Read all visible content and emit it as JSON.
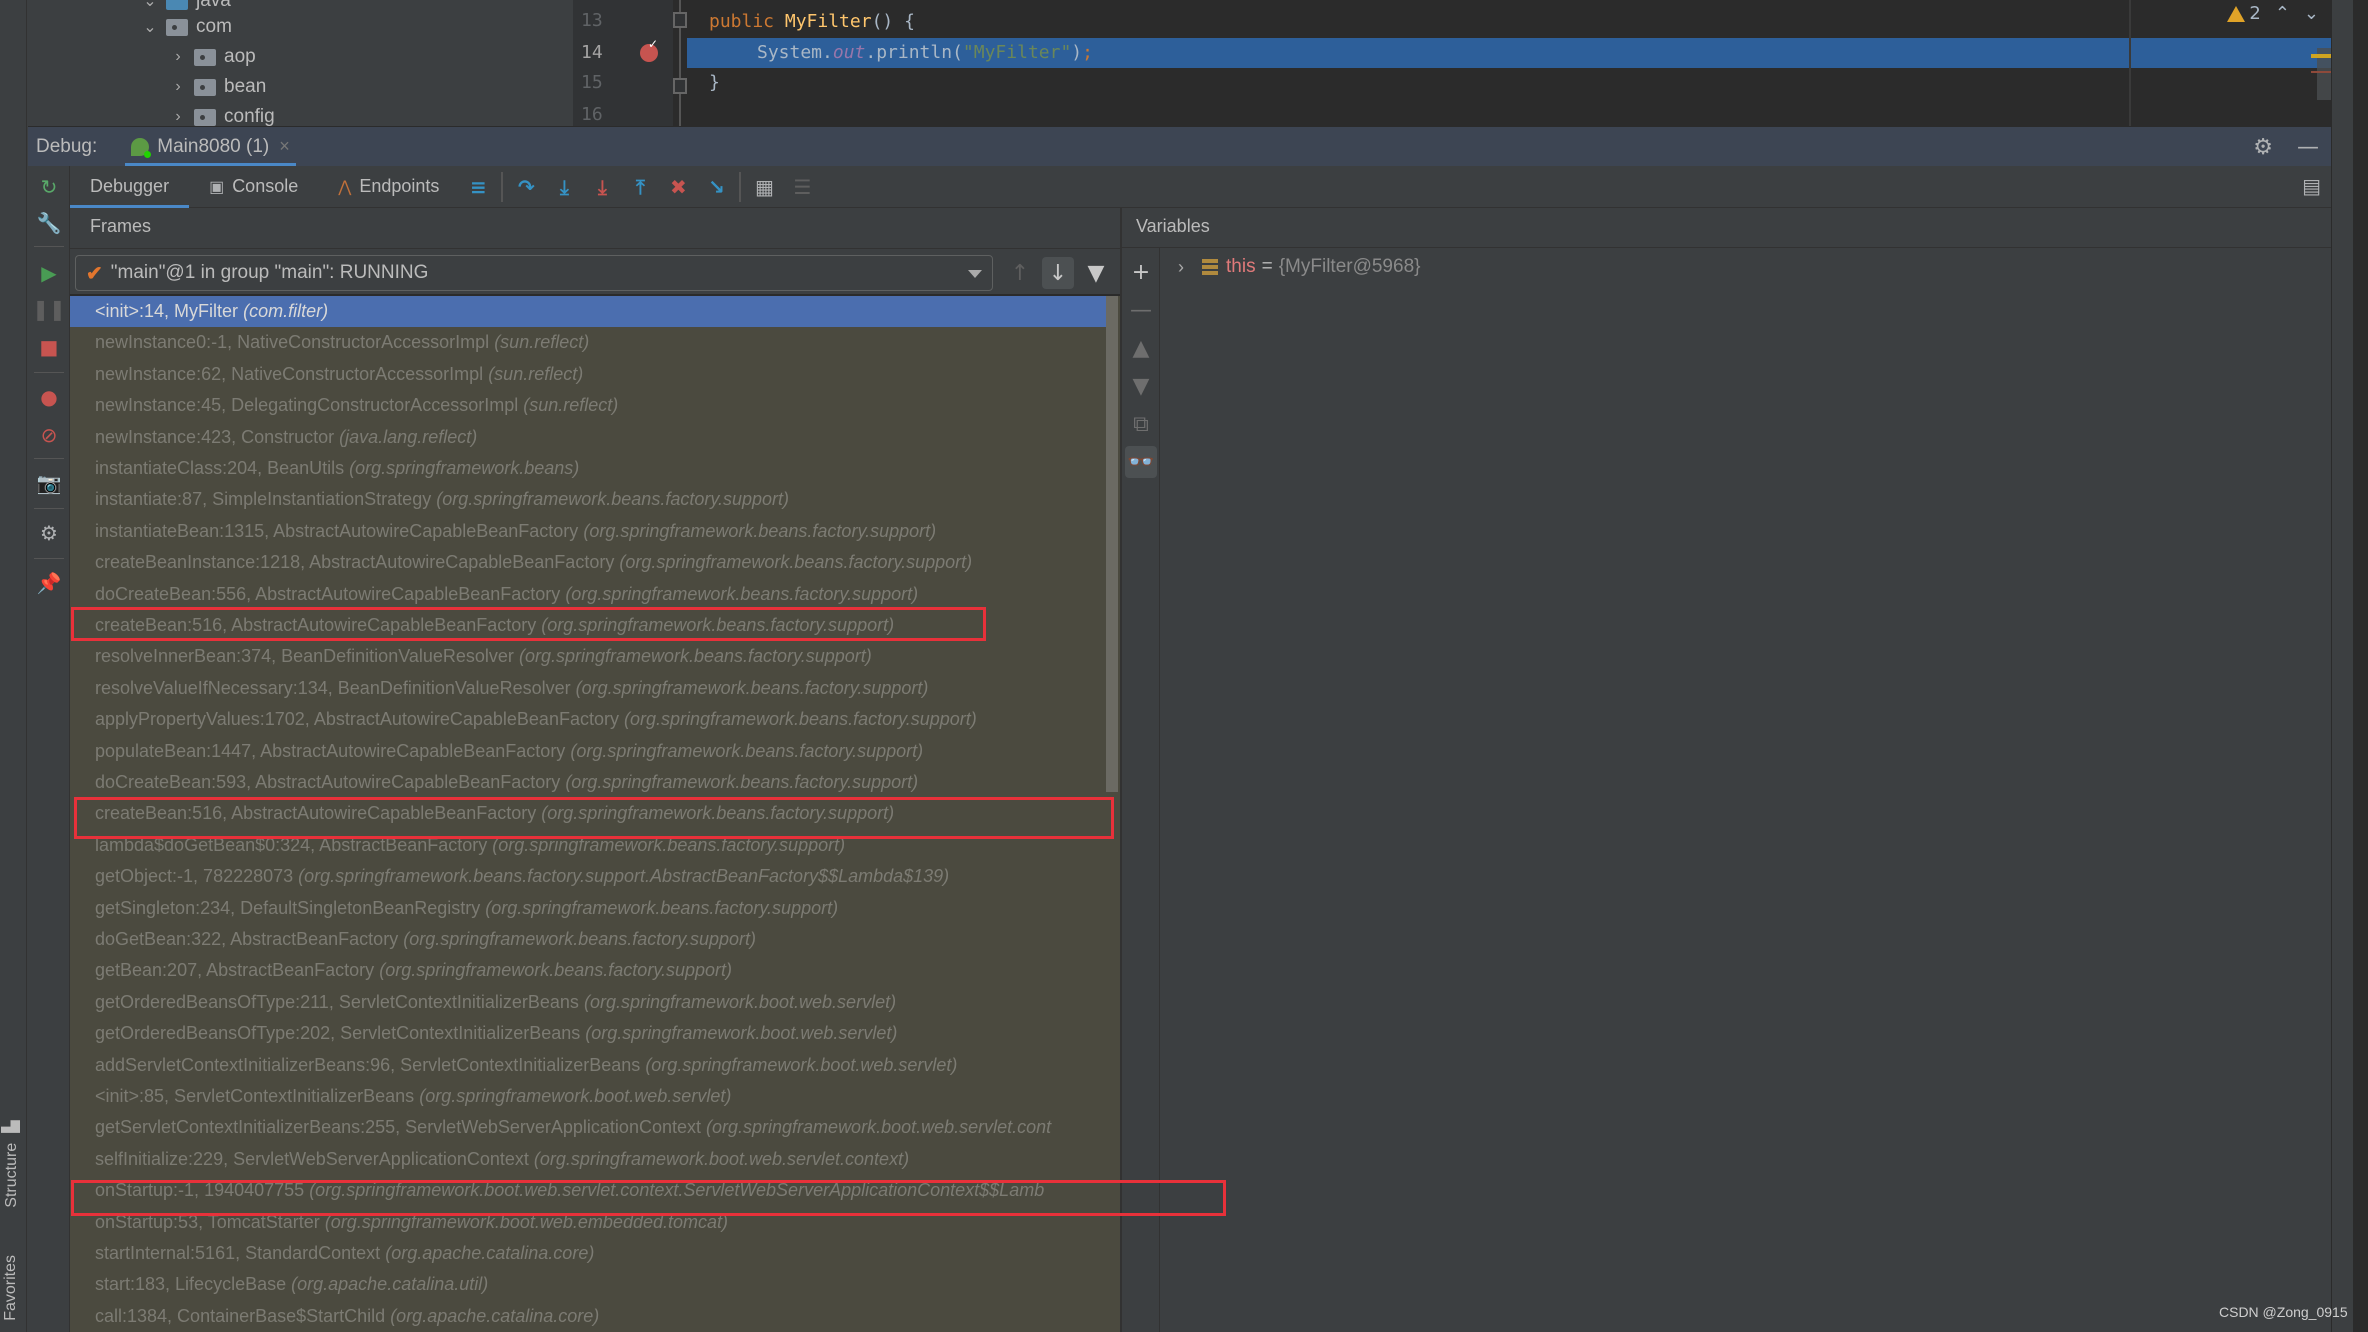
{
  "project_tree": {
    "items": [
      {
        "label": "java",
        "expanded": true
      },
      {
        "label": "com",
        "expanded": true
      },
      {
        "label": "aop",
        "expanded": false
      },
      {
        "label": "bean",
        "expanded": false
      },
      {
        "label": "config",
        "expanded": false
      }
    ]
  },
  "editor": {
    "lines": [
      {
        "number": "13",
        "code": "public MyFilter() {"
      },
      {
        "number": "14",
        "code": "System.out.println(\"MyFilter\");",
        "current": true,
        "breakpoint": true
      },
      {
        "number": "15",
        "code": "}"
      },
      {
        "number": "16",
        "code": ""
      }
    ],
    "warnings_count": "2"
  },
  "debug": {
    "label": "Debug:",
    "session_tab": "Main8080 (1)",
    "tabs": [
      {
        "label": "Debugger",
        "active": true
      },
      {
        "label": "Console",
        "active": false
      },
      {
        "label": "Endpoints",
        "active": false
      }
    ],
    "toolbar_icons": [
      "show-execution-point-icon",
      "step-over-icon",
      "step-into-icon",
      "force-step-into-icon",
      "step-out-icon",
      "drop-frame-icon",
      "run-to-cursor-icon",
      "evaluate-expression-icon",
      "trace-current-stream-icon"
    ],
    "side_tools": [
      "rerun-icon",
      "modify-settings-icon",
      "resume-icon",
      "pause-icon",
      "stop-icon",
      "view-breakpoints-icon",
      "mute-breakpoints-icon",
      "snapshot-icon",
      "settings-icon",
      "pin-icon"
    ]
  },
  "frames": {
    "title": "Frames",
    "thread": "\"main\"@1 in group \"main\": RUNNING",
    "items": [
      {
        "method": "<init>:14, MyFilter",
        "pkg": "(com.filter)",
        "selected": true
      },
      {
        "method": "newInstance0:-1, NativeConstructorAccessorImpl",
        "pkg": "(sun.reflect)"
      },
      {
        "method": "newInstance:62, NativeConstructorAccessorImpl",
        "pkg": "(sun.reflect)"
      },
      {
        "method": "newInstance:45, DelegatingConstructorAccessorImpl",
        "pkg": "(sun.reflect)"
      },
      {
        "method": "newInstance:423, Constructor",
        "pkg": "(java.lang.reflect)"
      },
      {
        "method": "instantiateClass:204, BeanUtils",
        "pkg": "(org.springframework.beans)"
      },
      {
        "method": "instantiate:87, SimpleInstantiationStrategy",
        "pkg": "(org.springframework.beans.factory.support)"
      },
      {
        "method": "instantiateBean:1315, AbstractAutowireCapableBeanFactory",
        "pkg": "(org.springframework.beans.factory.support)"
      },
      {
        "method": "createBeanInstance:1218, AbstractAutowireCapableBeanFactory",
        "pkg": "(org.springframework.beans.factory.support)"
      },
      {
        "method": "doCreateBean:556, AbstractAutowireCapableBeanFactory",
        "pkg": "(org.springframework.beans.factory.support)"
      },
      {
        "method": "createBean:516, AbstractAutowireCapableBeanFactory",
        "pkg": "(org.springframework.beans.factory.support)",
        "highlighted": true
      },
      {
        "method": "resolveInnerBean:374, BeanDefinitionValueResolver",
        "pkg": "(org.springframework.beans.factory.support)"
      },
      {
        "method": "resolveValueIfNecessary:134, BeanDefinitionValueResolver",
        "pkg": "(org.springframework.beans.factory.support)"
      },
      {
        "method": "applyPropertyValues:1702, AbstractAutowireCapableBeanFactory",
        "pkg": "(org.springframework.beans.factory.support)"
      },
      {
        "method": "populateBean:1447, AbstractAutowireCapableBeanFactory",
        "pkg": "(org.springframework.beans.factory.support)"
      },
      {
        "method": "doCreateBean:593, AbstractAutowireCapableBeanFactory",
        "pkg": "(org.springframework.beans.factory.support)"
      },
      {
        "method": "createBean:516, AbstractAutowireCapableBeanFactory",
        "pkg": "(org.springframework.beans.factory.support)",
        "highlighted": true
      },
      {
        "method": "lambda$doGetBean$0:324, AbstractBeanFactory",
        "pkg": "(org.springframework.beans.factory.support)"
      },
      {
        "method": "getObject:-1, 782228073",
        "pkg": "(org.springframework.beans.factory.support.AbstractBeanFactory$$Lambda$139)"
      },
      {
        "method": "getSingleton:234, DefaultSingletonBeanRegistry",
        "pkg": "(org.springframework.beans.factory.support)"
      },
      {
        "method": "doGetBean:322, AbstractBeanFactory",
        "pkg": "(org.springframework.beans.factory.support)"
      },
      {
        "method": "getBean:207, AbstractBeanFactory",
        "pkg": "(org.springframework.beans.factory.support)"
      },
      {
        "method": "getOrderedBeansOfType:211, ServletContextInitializerBeans",
        "pkg": "(org.springframework.boot.web.servlet)"
      },
      {
        "method": "getOrderedBeansOfType:202, ServletContextInitializerBeans",
        "pkg": "(org.springframework.boot.web.servlet)"
      },
      {
        "method": "addServletContextInitializerBeans:96, ServletContextInitializerBeans",
        "pkg": "(org.springframework.boot.web.servlet)"
      },
      {
        "method": "<init>:85, ServletContextInitializerBeans",
        "pkg": "(org.springframework.boot.web.servlet)"
      },
      {
        "method": "getServletContextInitializerBeans:255, ServletWebServerApplicationContext",
        "pkg": "(org.springframework.boot.web.servlet.cont"
      },
      {
        "method": "selfInitialize:229, ServletWebServerApplicationContext",
        "pkg": "(org.springframework.boot.web.servlet.context)"
      },
      {
        "method": "onStartup:-1, 1940407755",
        "pkg": "(org.springframework.boot.web.servlet.context.ServletWebServerApplicationContext$$Lamb",
        "highlighted": true
      },
      {
        "method": "onStartup:53, TomcatStarter",
        "pkg": "(org.springframework.boot.web.embedded.tomcat)"
      },
      {
        "method": "startInternal:5161, StandardContext",
        "pkg": "(org.apache.catalina.core)"
      },
      {
        "method": "start:183, LifecycleBase",
        "pkg": "(org.apache.catalina.util)"
      },
      {
        "method": "call:1384, ContainerBase$StartChild",
        "pkg": "(org.apache.catalina.core)"
      }
    ]
  },
  "variables": {
    "title": "Variables",
    "items": [
      {
        "name": "this",
        "eq": "=",
        "value": "{MyFilter@5968}"
      }
    ]
  },
  "side_tabs": {
    "structure": "Structure",
    "favorites": "Favorites"
  },
  "watermark": "CSDN @Zong_0915",
  "colors": {
    "accent": "#4a88c7",
    "selection": "#4b6eaf",
    "highlight_box": "#e8313a",
    "exec_line": "#2d5f9a"
  }
}
